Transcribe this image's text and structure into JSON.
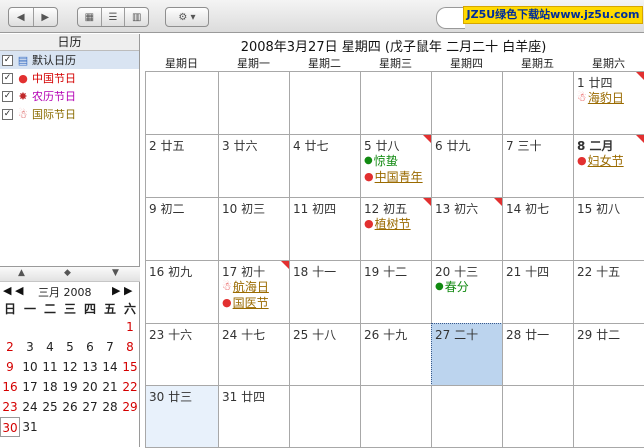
{
  "toolbar": {
    "back_icon": "back-arrow-icon",
    "forward_icon": "forward-arrow-icon",
    "view_icons": [
      "grid-view-icon",
      "list-view-icon",
      "column-view-icon"
    ],
    "settings_icon": "gear-icon",
    "search_icon": "search-icon",
    "banner": "JZ5U绿色下载站www.jz5u.com"
  },
  "sidebar": {
    "title": "日历",
    "calendars": [
      {
        "name": "默认日历",
        "color": "#111111",
        "icon": "calendar-icon"
      },
      {
        "name": "中国节日",
        "color": "#d40000",
        "icon": "balloon-icon"
      },
      {
        "name": "农历节日",
        "color": "#b400b4",
        "icon": "firecracker-icon"
      },
      {
        "name": "国际节日",
        "color": "#8a6b00",
        "icon": "santa-icon"
      }
    ]
  },
  "mini_calendar": {
    "title": "三月 2008",
    "weekdays": [
      "日",
      "一",
      "二",
      "三",
      "四",
      "五",
      "六"
    ],
    "weeks": [
      [
        "",
        "",
        "",
        "",
        "",
        "",
        "1"
      ],
      [
        "2",
        "3",
        "4",
        "5",
        "6",
        "7",
        "8"
      ],
      [
        "9",
        "10",
        "11",
        "12",
        "13",
        "14",
        "15"
      ],
      [
        "16",
        "17",
        "18",
        "19",
        "20",
        "21",
        "22"
      ],
      [
        "23",
        "24",
        "25",
        "26",
        "27",
        "28",
        "29"
      ],
      [
        "30",
        "31",
        "",
        "",
        "",
        "",
        ""
      ]
    ]
  },
  "month_view": {
    "title": "2008年3月27日 星期四 (戊子鼠年 二月二十 白羊座)",
    "weekdays": [
      "星期日",
      "星期一",
      "星期二",
      "星期三",
      "星期四",
      "星期五",
      "星期六"
    ],
    "weeks": [
      [
        {
          "label": ""
        },
        {
          "label": ""
        },
        {
          "label": ""
        },
        {
          "label": ""
        },
        {
          "label": ""
        },
        {
          "label": ""
        },
        {
          "label": "1 廿四",
          "marked": true,
          "events": [
            {
              "type": "santa",
              "text": "海豹日"
            }
          ]
        }
      ],
      [
        {
          "label": "2 廿五"
        },
        {
          "label": "3 廿六"
        },
        {
          "label": "4 廿七"
        },
        {
          "label": "5 廿八",
          "marked": true,
          "events": [
            {
              "type": "dot",
              "text": "惊蛰"
            },
            {
              "type": "balloon",
              "text": "中国青年"
            }
          ]
        },
        {
          "label": "6 廿九"
        },
        {
          "label": "7 三十"
        },
        {
          "label": "8 二月",
          "marked": true,
          "events": [
            {
              "type": "balloon",
              "text": "妇女节"
            }
          ]
        }
      ],
      [
        {
          "label": "9 初二"
        },
        {
          "label": "10 初三"
        },
        {
          "label": "11 初四"
        },
        {
          "label": "12 初五",
          "marked": true,
          "events": [
            {
              "type": "balloon",
              "text": "植树节"
            }
          ]
        },
        {
          "label": "13 初六",
          "marked": true
        },
        {
          "label": "14 初七"
        },
        {
          "label": "15 初八"
        }
      ],
      [
        {
          "label": "16 初九"
        },
        {
          "label": "17 初十",
          "marked": true,
          "events": [
            {
              "type": "santa",
              "text": "航海日"
            },
            {
              "type": "balloon",
              "text": "国医节"
            }
          ]
        },
        {
          "label": "18 十一"
        },
        {
          "label": "19 十二"
        },
        {
          "label": "20 十三",
          "events": [
            {
              "type": "dot",
              "text": "春分"
            }
          ]
        },
        {
          "label": "21 十四"
        },
        {
          "label": "22 十五"
        }
      ],
      [
        {
          "label": "23 十六"
        },
        {
          "label": "24 十七"
        },
        {
          "label": "25 十八"
        },
        {
          "label": "26 十九"
        },
        {
          "label": "27 二十",
          "selected": true
        },
        {
          "label": "28 廿一"
        },
        {
          "label": "29 廿二"
        }
      ],
      [
        {
          "label": "30 廿三",
          "today": true
        },
        {
          "label": "31 廿四"
        },
        {
          "label": ""
        },
        {
          "label": ""
        },
        {
          "label": ""
        },
        {
          "label": ""
        },
        {
          "label": ""
        }
      ]
    ]
  },
  "colors": {
    "event_link": "#9a6a00",
    "solar_term": "#118a11",
    "selected_cell": "#bcd4ee",
    "today_cell": "#e8f1fb",
    "marker": "#e23030"
  }
}
